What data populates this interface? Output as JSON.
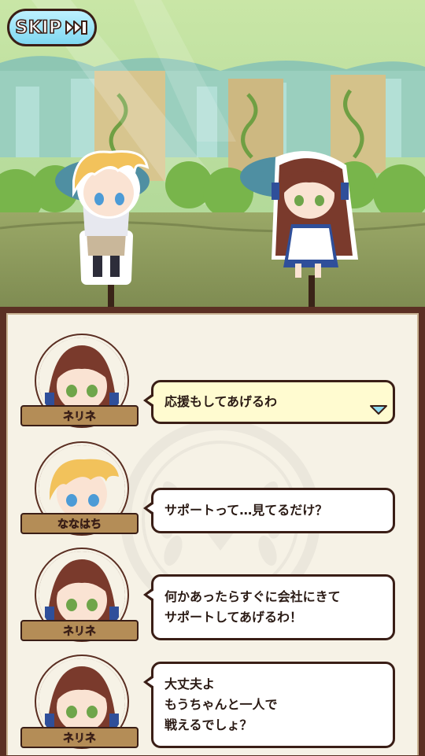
{
  "skip_button": {
    "label": "SKIP",
    "icon": "fast-forward-icon"
  },
  "dialogue": [
    {
      "speaker": "ネリネ",
      "text": "応援もしてあげるわ",
      "active": true
    },
    {
      "speaker": "ななはち",
      "text": "サポートって…見てるだけ？",
      "active": false
    },
    {
      "speaker": "ネリネ",
      "text": "何かあったらすぐに会社にきて\nサポートしてあげるわ！",
      "active": false
    },
    {
      "speaker": "ネリネ",
      "text": "大丈夫よ\nもうちゃんと一人で\n戦えるでしょ？",
      "active": false
    }
  ],
  "colors": {
    "frame": "#5b3024",
    "panel": "#f6f2e6",
    "skip": "#8fdcf2",
    "nameplate": "#b48d57",
    "active_bubble": "#fffbd0"
  }
}
